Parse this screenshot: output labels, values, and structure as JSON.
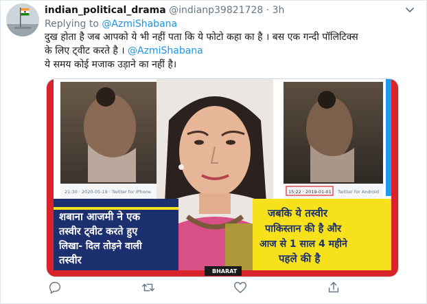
{
  "tweet": {
    "display_name": "indian_political_drama",
    "handle": "@indianp39821728",
    "separator": "·",
    "time": "3h",
    "replying_prefix": "Replying to",
    "replying_to": "@AzmiShabana",
    "line1": "दुख होता है जब आपको ये भी नहीं पता कि ये फोटो कहा का है । बस एक गन्दी पॉलिटिक्स",
    "line2_text": "के लिए ट्वीट करते है । ",
    "line2_mention": "@AzmiShabana",
    "line3": "ये समय कोई मजाक उड़ाने का नहीं है।"
  },
  "media": {
    "left_timestamp": "21:30 · 2020-05-19 · Twitter for iPhone",
    "right_timestamp_date": "15:22 · 2019-01-01",
    "right_timestamp_app": "Twitter for Android",
    "left_caption_line1": "शबाना आजमी ने एक",
    "left_caption_line2": "तस्वीर ट्वीट करते हुए",
    "left_caption_line3": "लिखा- दिल तोड़ने वाली",
    "left_caption_line4": "तस्वीर",
    "right_caption_line1": "जबकि ये तस्वीर",
    "right_caption_line2": "पाकिस्तान की है और",
    "right_caption_line3": "आज से 1 साल 4 महीने",
    "right_caption_line4": "पहले की है",
    "watermark": "BHARAT",
    "colors": {
      "yellow": "#f7e11a",
      "navy": "#1c2f6e",
      "red": "#d8232a",
      "blue": "#1d9bf0"
    }
  },
  "actions": {
    "reply_icon": "reply-icon",
    "retweet_icon": "retweet-icon",
    "like_icon": "heart-icon",
    "share_icon": "share-icon"
  },
  "accent": "#1b95e0"
}
